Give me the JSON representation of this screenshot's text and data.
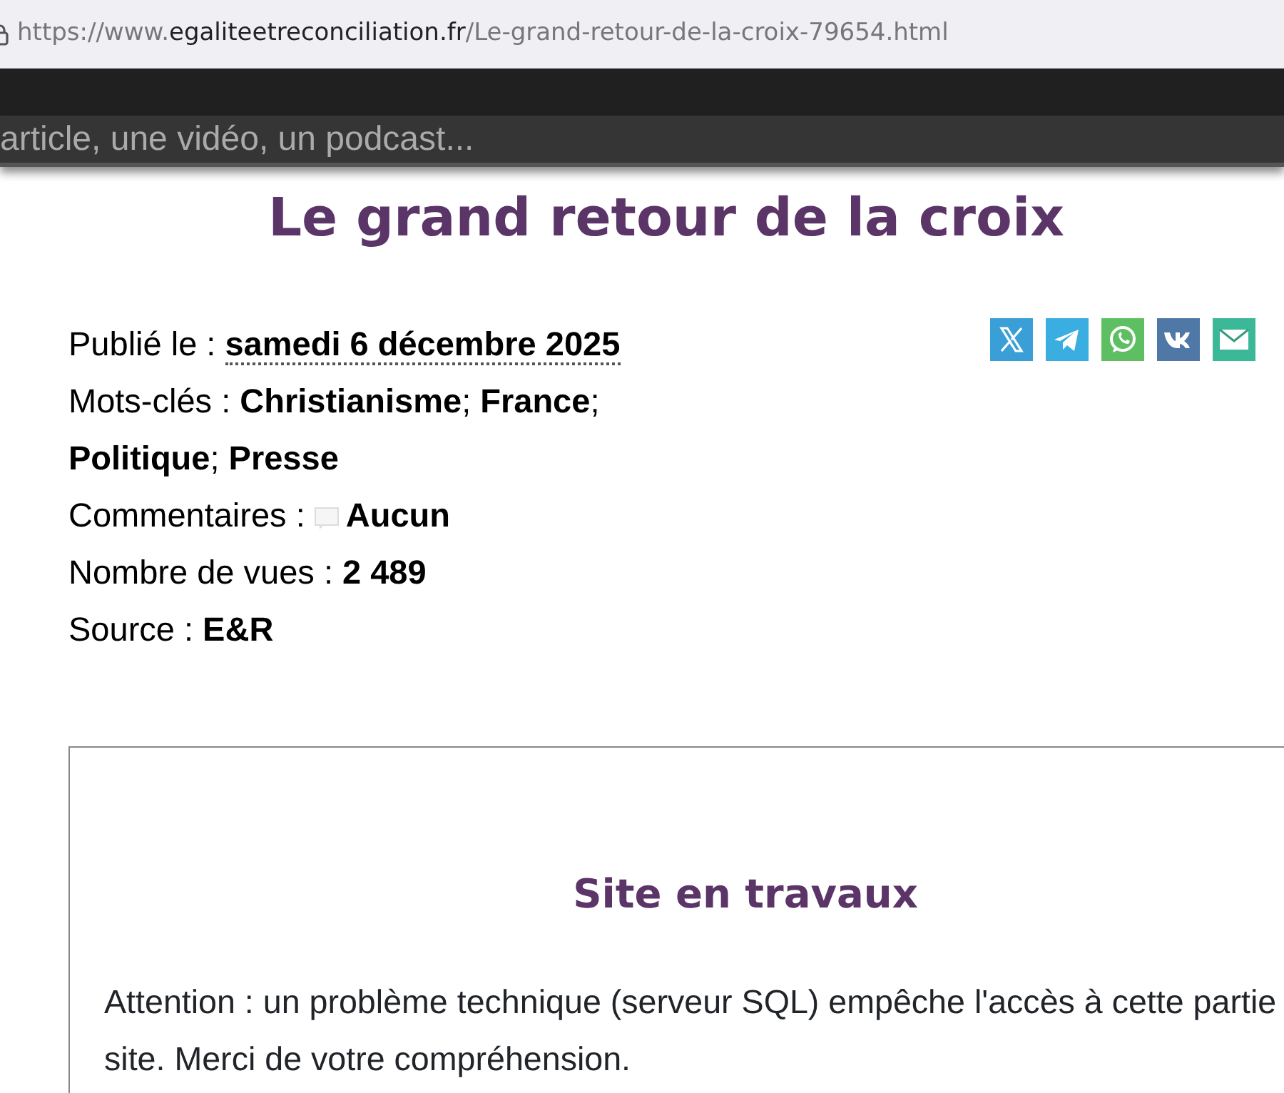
{
  "address_bar": {
    "scheme": "https://www.",
    "domain": "egaliteetreconciliation.fr",
    "path": "/Le-grand-retour-de-la-croix-79654.html"
  },
  "search": {
    "placeholder": "article, une vidéo, un podcast..."
  },
  "article": {
    "title": "Le grand retour de la croix",
    "meta": [
      {
        "kind": "date",
        "label": "Publié le :",
        "value": "samedi 6 décembre 2025"
      },
      {
        "kind": "text",
        "label": "Mots-clés :",
        "value": "**Christianisme**; **France**; **Politique**; **Presse**"
      },
      {
        "kind": "comments",
        "label": "Commentaires :",
        "value": "Aucun"
      },
      {
        "kind": "text",
        "label": "Nombre de vues :",
        "value": "**2 489**"
      },
      {
        "kind": "text",
        "label": "Source :",
        "value": "**E&R**"
      }
    ],
    "share": [
      {
        "kind": "x",
        "color": "#3a9fd6"
      },
      {
        "kind": "telegram",
        "color": "#3aaee0"
      },
      {
        "kind": "whatsapp",
        "color": "#5dbf62"
      },
      {
        "kind": "vk",
        "color": "#4f78a6"
      },
      {
        "kind": "mail",
        "color": "#3bb897"
      }
    ]
  },
  "notice": {
    "title": "Site en travaux",
    "lines": [
      "Attention : un problème technique (serveur SQL) empêche l'accès à cette partie",
      "site. Merci de votre compréhension."
    ]
  }
}
